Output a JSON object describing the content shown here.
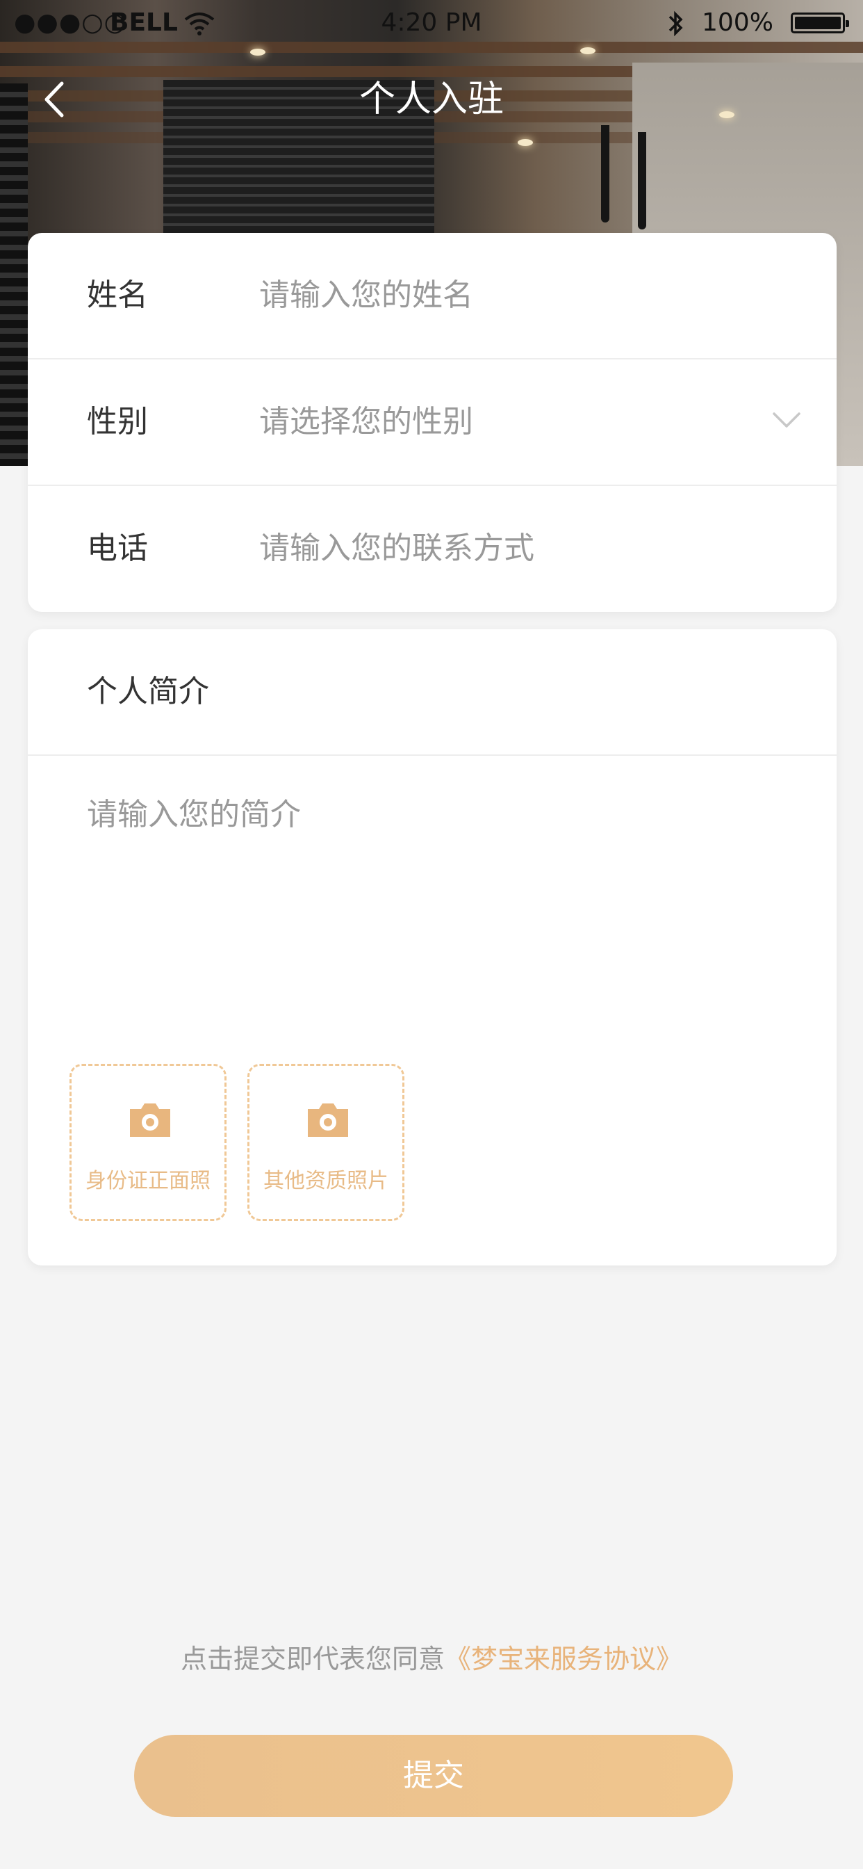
{
  "status_bar": {
    "signal": "●●●○○",
    "carrier": "BELL",
    "time": "4:20 PM",
    "battery_percent": "100%",
    "battery_level": 1.0
  },
  "nav": {
    "title": "个人入驻"
  },
  "form": {
    "name": {
      "label": "姓名",
      "placeholder": "请输入您的姓名"
    },
    "gender": {
      "label": "性别",
      "placeholder": "请选择您的性别"
    },
    "phone": {
      "label": "电话",
      "placeholder": "请输入您的联系方式"
    }
  },
  "intro": {
    "title": "个人简介",
    "placeholder": "请输入您的简介",
    "uploads": [
      {
        "label": "身份证正面照",
        "icon": "camera-icon"
      },
      {
        "label": "其他资质照片",
        "icon": "camera-icon"
      }
    ]
  },
  "agreement": {
    "prefix": "点击提交即代表您同意",
    "link": "《梦宝来服务协议》"
  },
  "submit_label": "提交",
  "colors": {
    "accent": "#EAC08D",
    "background": "#F4F4F4"
  }
}
